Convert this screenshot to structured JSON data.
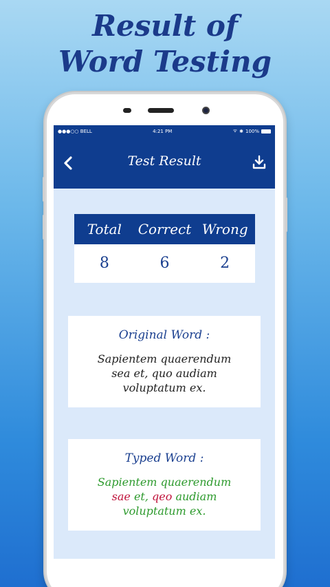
{
  "headline": {
    "line1": "Result of",
    "line2": "Word Testing"
  },
  "status_bar": {
    "carrier": "●●●○○ BELL",
    "time": "4:21 PM",
    "battery": "100%"
  },
  "app_bar": {
    "title": "Test Result",
    "back_icon": "chevron-left-icon",
    "download_icon": "download-icon"
  },
  "score": {
    "headers": [
      "Total",
      "Correct",
      "Wrong"
    ],
    "values": [
      "8",
      "6",
      "2"
    ]
  },
  "original_word": {
    "title": "Original Word :",
    "line1": "Sapientem quaerendum",
    "line2": "sea et, quo audiam",
    "line3": "voluptatum ex."
  },
  "typed_word": {
    "title": "Typed Word :",
    "line1": "Sapientem quaerendum",
    "line2_wrong1": "sae",
    "line2_ok1": " et, ",
    "line2_wrong2": "qeo",
    "line2_ok2": " audiam",
    "line3": "voluptatum ex."
  },
  "colors": {
    "primary": "#0f3d8f",
    "correct": "#2d9a2d",
    "wrong": "#c0143c",
    "screen_bg": "#dbe9fa"
  }
}
